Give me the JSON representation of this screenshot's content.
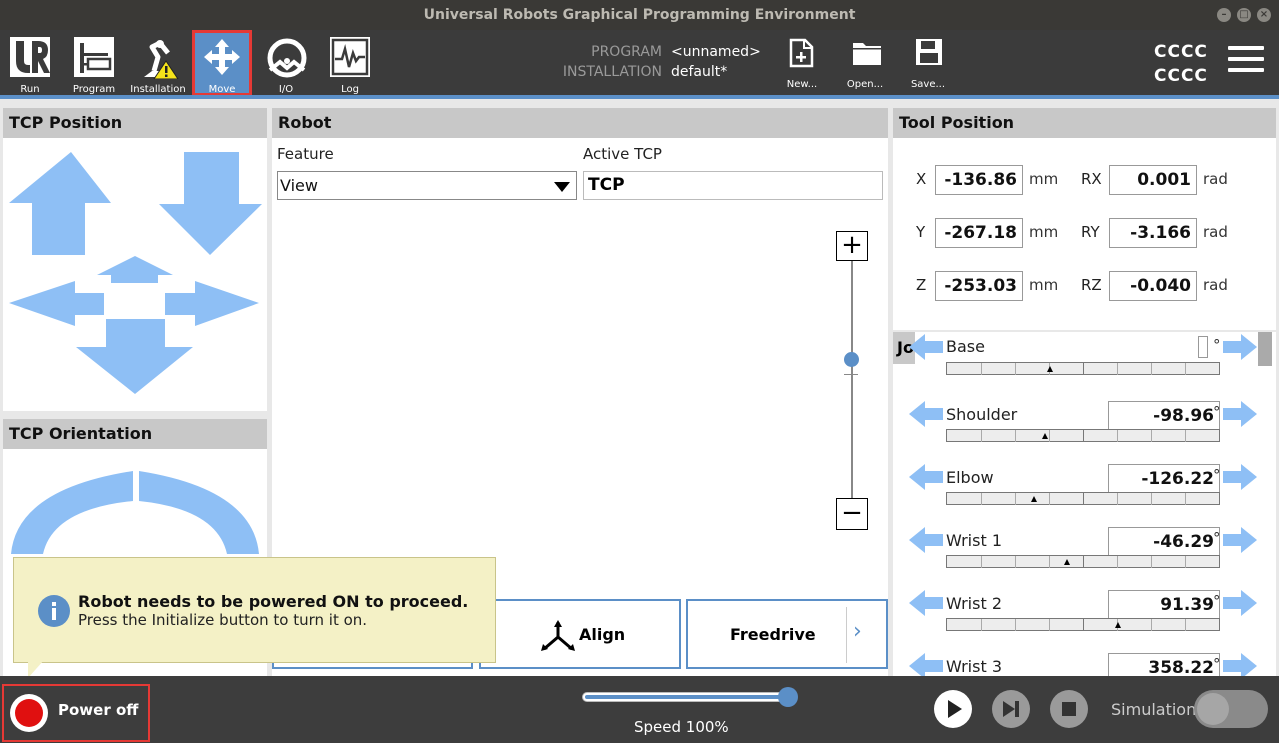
{
  "window": {
    "title": "Universal Robots Graphical Programming Environment"
  },
  "nav": {
    "run": "Run",
    "program": "Program",
    "installation": "Installation",
    "move": "Move",
    "io": "I/O",
    "log": "Log"
  },
  "program_info": {
    "program_key": "PROGRAM",
    "program_val": "<unnamed>",
    "installation_key": "INSTALLATION",
    "installation_val": "default*"
  },
  "file": {
    "new": "New...",
    "open": "Open...",
    "save": "Save..."
  },
  "user": {
    "line1": "CCCC",
    "line2": "CCCC"
  },
  "tcp_position": {
    "title": "TCP Position"
  },
  "tcp_orientation": {
    "title": "TCP Orientation"
  },
  "robot": {
    "title": "Robot",
    "feature_label": "Feature",
    "feature_value": "View",
    "active_tcp_label": "Active TCP",
    "active_tcp_value": "TCP",
    "zoom_in": "+",
    "zoom_out": "−",
    "align_label": "Align",
    "freedrive_label": "Freedrive",
    "freedrive_chevron": "›"
  },
  "tool_position": {
    "title": "Tool Position",
    "x_label": "X",
    "x_value": "-136.86",
    "x_unit": "mm",
    "y_label": "Y",
    "y_value": "-267.18",
    "y_unit": "mm",
    "z_label": "Z",
    "z_value": "-253.03",
    "z_unit": "mm",
    "rx_label": "RX",
    "rx_value": "0.001",
    "rx_unit": "rad",
    "ry_label": "RY",
    "ry_value": "-3.166",
    "ry_unit": "rad",
    "rz_label": "RZ",
    "rz_value": "-0.040",
    "rz_unit": "rad"
  },
  "joints": {
    "header_partial": "Jo",
    "degree": "°",
    "items": [
      {
        "name": "Base",
        "value": ""
      },
      {
        "name": "Shoulder",
        "value": "-98.96"
      },
      {
        "name": "Elbow",
        "value": "-126.22"
      },
      {
        "name": "Wrist 1",
        "value": "-46.29"
      },
      {
        "name": "Wrist 2",
        "value": "91.39"
      },
      {
        "name": "Wrist 3",
        "value": "358.22"
      }
    ]
  },
  "toast": {
    "title": "Robot needs to be powered ON to proceed.",
    "body": "Press the Initialize button to turn it on."
  },
  "bottom": {
    "power_label": "Power off",
    "speed_label": "Speed 100%",
    "speed_fraction": 1.0,
    "simulation_label": "Simulation"
  },
  "colors": {
    "accent": "#5b8fc7",
    "arrow": "#8ebff5",
    "power_red": "#e53935"
  }
}
